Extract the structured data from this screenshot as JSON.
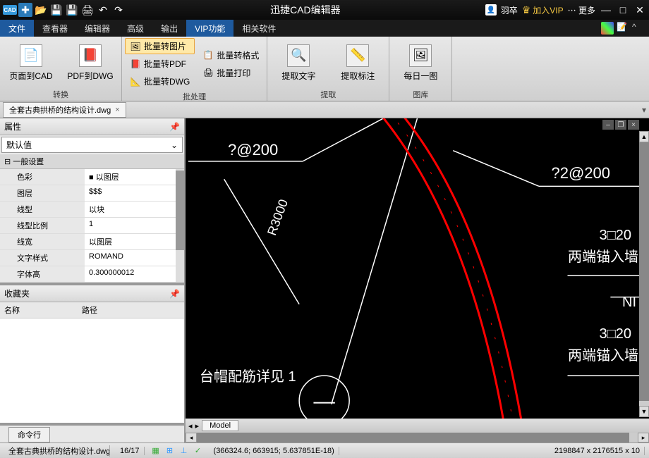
{
  "titlebar": {
    "logo": "CAD",
    "title": "迅捷CAD编辑器",
    "user": "羽卒",
    "vip_label": "加入VIP",
    "more_label": "更多"
  },
  "menubar": {
    "items": [
      "文件",
      "查看器",
      "编辑器",
      "高级",
      "输出",
      "VIP功能",
      "相关软件"
    ],
    "active_index": 5
  },
  "ribbon": {
    "groups": [
      {
        "label": "转换",
        "big_buttons": [
          {
            "label": "页面到CAD",
            "icon": "📄"
          },
          {
            "label": "PDF到DWG",
            "icon": "📕"
          }
        ]
      },
      {
        "label": "批处理",
        "small_buttons": [
          {
            "label": "批量转图片",
            "icon": "🖼",
            "highlight": true
          },
          {
            "label": "批量转PDF",
            "icon": "📕"
          },
          {
            "label": "批量转DWG",
            "icon": "📐"
          },
          {
            "label": "批量转格式",
            "icon": "📋"
          },
          {
            "label": "批量打印",
            "icon": "🖨"
          }
        ]
      },
      {
        "label": "提取",
        "big_buttons": [
          {
            "label": "提取文字",
            "icon": "🔍"
          },
          {
            "label": "提取标注",
            "icon": "📏"
          }
        ]
      },
      {
        "label": "图库",
        "big_buttons": [
          {
            "label": "每日一图",
            "icon": "🖼"
          }
        ]
      }
    ]
  },
  "doc_tab": {
    "filename": "全套古典拱桥的结构设计.dwg"
  },
  "properties": {
    "title": "属性",
    "combo": "默认值",
    "section": "一般设置",
    "rows": [
      {
        "key": "色彩",
        "val": "■ 以图层"
      },
      {
        "key": "图层",
        "val": "$$$"
      },
      {
        "key": "线型",
        "val": "以块"
      },
      {
        "key": "线型比例",
        "val": "1"
      },
      {
        "key": "线宽",
        "val": "以图层"
      },
      {
        "key": "文字样式",
        "val": "ROMAND"
      },
      {
        "key": "字体高",
        "val": "0.300000012"
      }
    ]
  },
  "favorites": {
    "title": "收藏夹",
    "col1": "名称",
    "col2": "路径"
  },
  "cmdline": {
    "label": "命令行"
  },
  "canvas": {
    "annotations": {
      "a1": "?@200",
      "a2": "?2@200",
      "a3": "R3000",
      "a4": "3□20",
      "a5": "两端锚入墙",
      "a6": "NI",
      "a7": "3□20",
      "a8": "两端锚入墙",
      "a9": "台帽配筋详见 1"
    },
    "model_tab": "Model"
  },
  "statusbar": {
    "file": "全套古典拱桥的结构设计.dwg",
    "pages": "16/17",
    "coords": "(366324.6; 663915; 5.637851E-18)",
    "dims": "2198847 x 2176515 x 10"
  }
}
